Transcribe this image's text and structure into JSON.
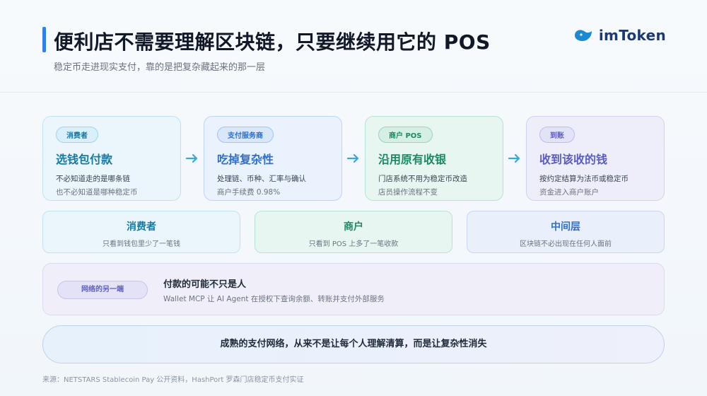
{
  "header": {
    "title": "便利店不需要理解区块链，只要继续用它的 POS",
    "subtitle": "稳定币走进现实支付，靠的是把复杂藏起来的那一层",
    "logo_text": "imToken",
    "accent_color": "#2f80ed"
  },
  "steps": [
    {
      "badge": "消费者",
      "title": "选钱包付款",
      "line1": "不必知道走的是哪条链",
      "line2": "也不必知道是哪种稳定币",
      "color": "#1679a6"
    },
    {
      "badge": "支付服务商",
      "title": "吃掉复杂性",
      "line1": "处理链、币种、汇率与确认",
      "line2": "商户手续费 0.98%",
      "color": "#2f6fd0"
    },
    {
      "badge": "商户 POS",
      "title": "沿用原有收银",
      "line1": "门店系统不用为稳定币改造",
      "line2": "店员操作流程不变",
      "color": "#1b8a63"
    },
    {
      "badge": "到账",
      "title": "收到该收的钱",
      "line1": "按约定结算为法币或稳定币",
      "line2": "资金进入商户账户",
      "color": "#5c5cc4"
    }
  ],
  "roles": [
    {
      "title": "消费者",
      "desc": "只看到钱包里少了一笔钱"
    },
    {
      "title": "商户",
      "desc": "只看到 POS 上多了一笔收款"
    },
    {
      "title": "中间层",
      "desc": "区块链不必出现在任何人面前"
    }
  ],
  "network": {
    "badge": "网络的另一端",
    "title": "付款的可能不只是人",
    "desc": "Wallet MCP 让 AI Agent 在授权下查询余额、转账并支付外部服务"
  },
  "banner": {
    "text": "成熟的支付网络，从来不是让每个人理解清算，而是让复杂性消失"
  },
  "footer": {
    "source": "来源：NETSTARS Stablecoin Pay 公开资料，HashPort 罗森门店稳定币支付实证"
  },
  "icons": {
    "logo": "imtoken-logo-icon",
    "arrow": "arrow-right-icon",
    "arrow_color": "#3aa7d8"
  }
}
